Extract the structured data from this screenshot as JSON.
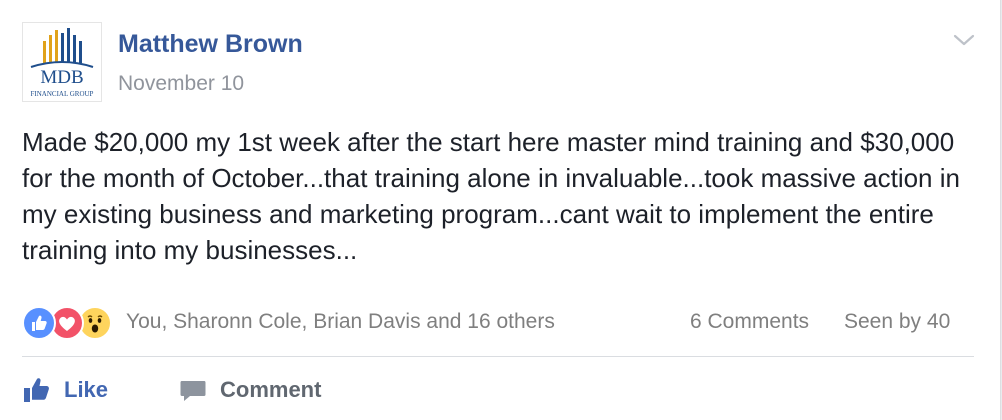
{
  "post": {
    "author": "Matthew Brown",
    "date": "November 10",
    "logo": {
      "text": "MDB",
      "subtext": "FINANCIAL GROUP"
    },
    "body": "Made $20,000 my 1st week after the start here master mind training and $30,000 for the month of October...that training alone in invaluable...took massive action in my existing business and marketing program...cant wait to implement the entire training into my businesses..."
  },
  "stats": {
    "reactions": [
      "like-icon",
      "love-icon",
      "wow-icon"
    ],
    "reactors": "You, Sharonn Cole, Brian Davis and 16 others",
    "comments": "6 Comments",
    "seen": "Seen by 40"
  },
  "actions": {
    "like_label": "Like",
    "comment_label": "Comment"
  },
  "colors": {
    "link_blue": "#365899",
    "like_blue": "#4267b2",
    "muted_gray": "#90949c",
    "love_red": "#f25268",
    "wow_yellow": "#fed45d",
    "logo_blue": "#1f4e8c",
    "logo_gold": "#e0a21a"
  }
}
